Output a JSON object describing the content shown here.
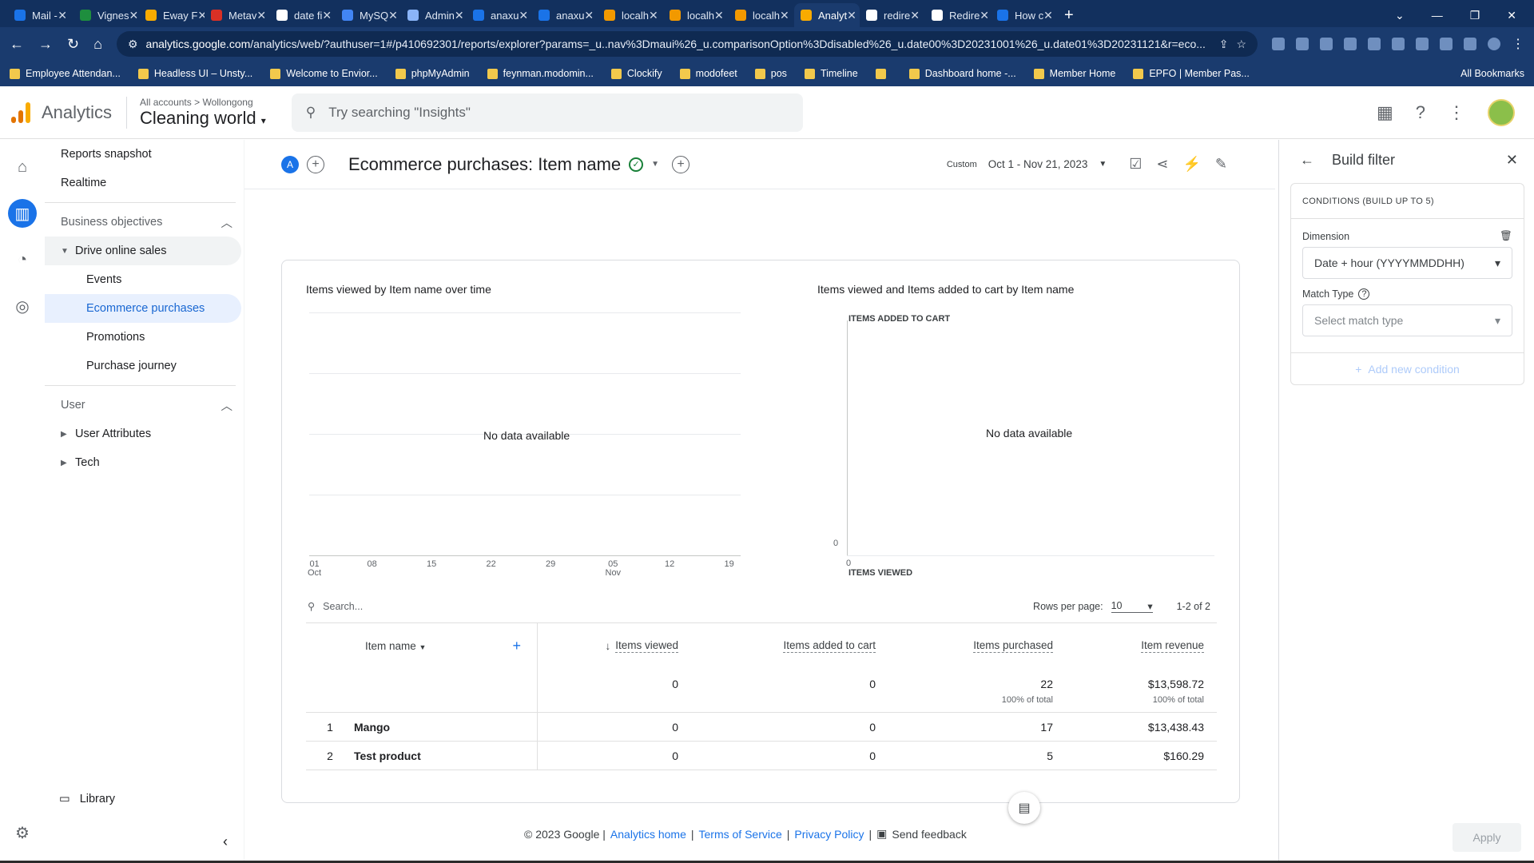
{
  "browser": {
    "tabs": [
      {
        "label": "Mail -",
        "color": "#1a73e8"
      },
      {
        "label": "Vignes",
        "color": "#1e8e3e"
      },
      {
        "label": "Eway F",
        "color": "#f9ab00"
      },
      {
        "label": "Metav",
        "color": "#d93025"
      },
      {
        "label": "date fi",
        "color": "#fff"
      },
      {
        "label": "MySQ",
        "color": "#4285f4"
      },
      {
        "label": "Admin",
        "color": "#8ab4f8"
      },
      {
        "label": "anaxu",
        "color": "#1a73e8"
      },
      {
        "label": "anaxu",
        "color": "#1a73e8"
      },
      {
        "label": "localh",
        "color": "#f29900"
      },
      {
        "label": "localh",
        "color": "#f29900"
      },
      {
        "label": "localh",
        "color": "#f29900"
      },
      {
        "label": "Analyt",
        "color": "#f9ab00"
      },
      {
        "label": "redire",
        "color": "#fff"
      },
      {
        "label": "Redire",
        "color": "#fff"
      },
      {
        "label": "How c",
        "color": "#1a73e8"
      }
    ],
    "active_tab_index": 12,
    "new_tab": "+",
    "url_host": "analytics.google.com",
    "url_rest": "/analytics/web/?authuser=1#/p410692301/reports/explorer?params=_u..nav%3Dmaui%26_u.comparisonOption%3Ddisabled%26_u.date00%3D20231001%26_u.date01%3D20231121&r=eco...",
    "bookmarks": [
      "Employee Attendan...",
      "Headless UI – Unsty...",
      "Welcome to Envior...",
      "phpMyAdmin",
      "feynman.modomin...",
      "Clockify",
      "modofeet",
      "pos",
      "Timeline",
      "",
      "Dashboard home -...",
      "Member Home",
      "EPFO | Member Pas..."
    ],
    "all_bookmarks": "All Bookmarks"
  },
  "app": {
    "name": "Analytics",
    "crumb_all": "All accounts",
    "crumb_sep": ">",
    "crumb_account": "Wollongong",
    "property": "Cleaning world",
    "search_placeholder": "Try searching \"Insights\""
  },
  "sidenav": {
    "top": [
      "Reports snapshot",
      "Realtime"
    ],
    "section1": "Business objectives",
    "group_open": "Drive online sales",
    "group_items": [
      "Events",
      "Ecommerce purchases",
      "Promotions",
      "Purchase journey"
    ],
    "selected_item": "Ecommerce purchases",
    "section2": "User",
    "user_items": [
      "User Attributes",
      "Tech"
    ],
    "library": "Library"
  },
  "report": {
    "title": "Ecommerce purchases: Item name",
    "chip": "A",
    "date_label": "Custom",
    "date_range": "Oct 1 - Nov 21, 2023"
  },
  "line_chart": {
    "title": "Items viewed by Item name over time",
    "no_data": "No data available",
    "x_ticks": [
      {
        "top": "01",
        "bottom": "Oct"
      },
      {
        "top": "08",
        "bottom": ""
      },
      {
        "top": "15",
        "bottom": ""
      },
      {
        "top": "22",
        "bottom": ""
      },
      {
        "top": "29",
        "bottom": ""
      },
      {
        "top": "05",
        "bottom": "Nov"
      },
      {
        "top": "12",
        "bottom": ""
      },
      {
        "top": "19",
        "bottom": ""
      }
    ]
  },
  "scatter_chart": {
    "title": "Items viewed and Items added to cart by Item name",
    "y_label": "ITEMS ADDED TO CART",
    "x_label": "ITEMS VIEWED",
    "y_zero": "0",
    "x_zero": "0",
    "no_data": "No data available"
  },
  "table": {
    "search_placeholder": "Search...",
    "rows_per_page_label": "Rows per page:",
    "rows_per_page": "10",
    "pagination": "1-2 of 2",
    "columns": {
      "item_name": "Item name",
      "items_viewed": "Items viewed",
      "items_added": "Items added to cart",
      "items_purchased": "Items purchased",
      "item_revenue": "Item revenue"
    },
    "totals": {
      "items_viewed": "0",
      "items_added": "0",
      "items_purchased": "22",
      "items_purchased_sub": "100% of total",
      "item_revenue": "$13,598.72",
      "item_revenue_sub": "100% of total"
    },
    "rows": [
      {
        "index": "1",
        "name": "Mango",
        "viewed": "0",
        "added": "0",
        "purchased": "17",
        "revenue": "$13,438.43"
      },
      {
        "index": "2",
        "name": "Test product",
        "viewed": "0",
        "added": "0",
        "purchased": "5",
        "revenue": "$160.29"
      }
    ]
  },
  "footer": {
    "copyright": "© 2023 Google |",
    "links": [
      "Analytics home",
      "Terms of Service",
      "Privacy Policy"
    ],
    "sep": "|",
    "feedback": "Send feedback"
  },
  "filter_panel": {
    "title": "Build filter",
    "conditions_header": "CONDITIONS (BUILD UP TO 5)",
    "dimension_label": "Dimension",
    "dimension_value": "Date + hour (YYYYMMDDHH)",
    "match_type_label": "Match Type",
    "match_type_placeholder": "Select match type",
    "add_condition": "Add new condition",
    "apply": "Apply"
  }
}
